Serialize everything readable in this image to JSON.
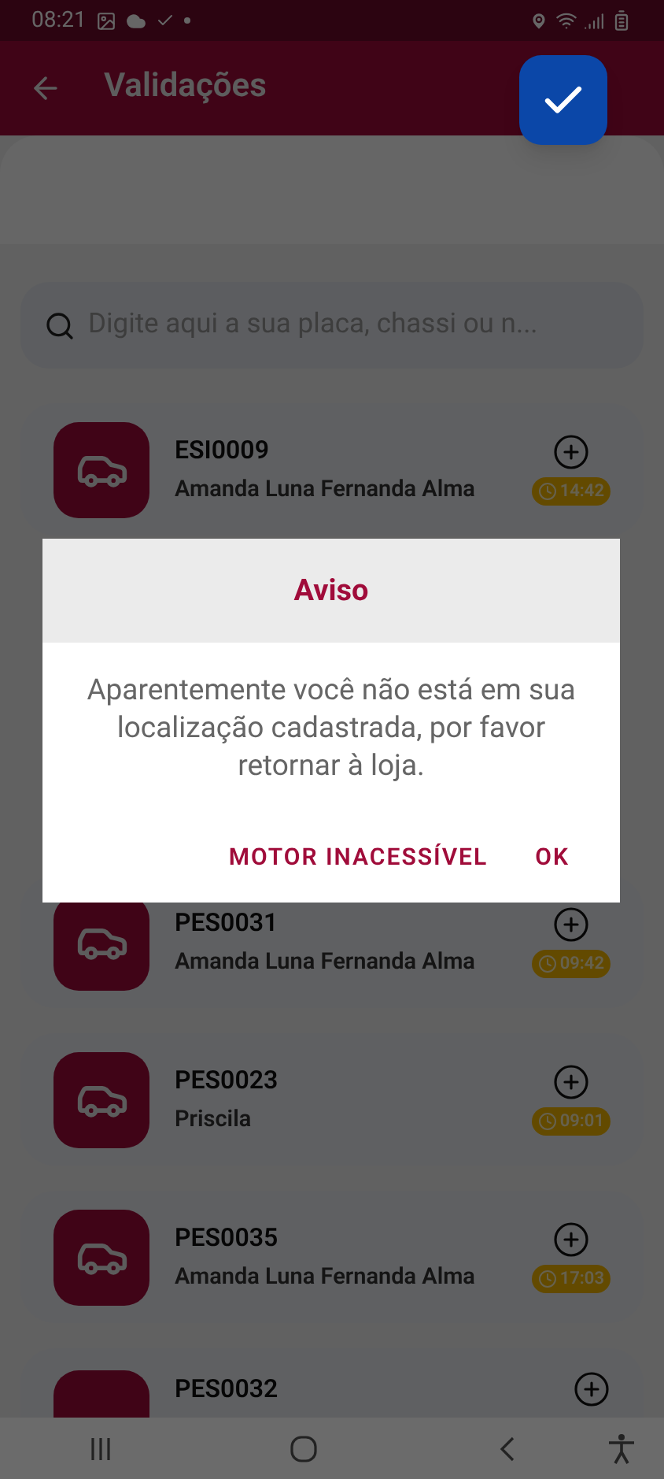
{
  "status_bar": {
    "time": "08:21"
  },
  "app_bar": {
    "title": "Validações"
  },
  "search": {
    "placeholder": "Digite aqui a sua placa, chassi ou n..."
  },
  "items": [
    {
      "plate": "ESI0009",
      "name": "Amanda Luna Fernanda Alma",
      "time": "14:42"
    },
    {
      "plate": "PES0031",
      "name": "Amanda Luna Fernanda Alma",
      "time": "09:42"
    },
    {
      "plate": "PES0023",
      "name": "Priscila",
      "time": "09:01"
    },
    {
      "plate": "PES0035",
      "name": "Amanda Luna Fernanda Alma",
      "time": "17:03"
    },
    {
      "plate": "PES0032"
    }
  ],
  "dialog": {
    "title": "Aviso",
    "message": "Aparentemente você não está em sua localização cadastrada, por favor retornar à loja.",
    "buttons": [
      "MOTOR INACESSÍVEL",
      "OK"
    ]
  }
}
